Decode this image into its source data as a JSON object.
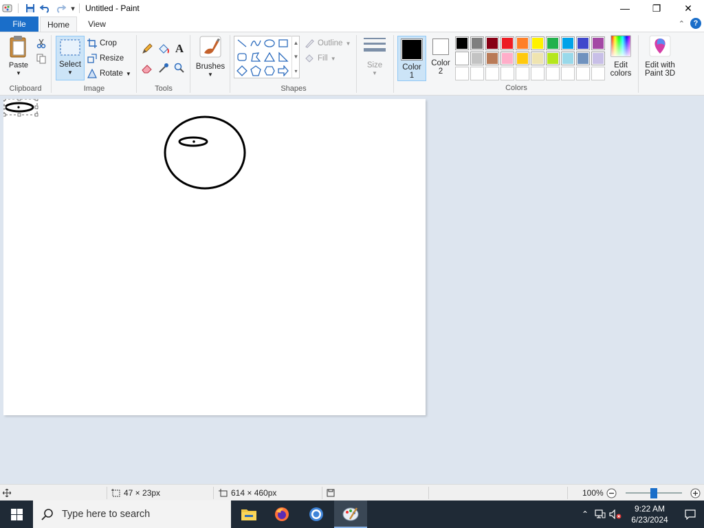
{
  "window": {
    "title": "Untitled - Paint",
    "minimize": "—",
    "restore": "❐",
    "close": "✕"
  },
  "quick_access": {
    "dropdown": "▾"
  },
  "tabs": {
    "file": "File",
    "home": "Home",
    "view": "View"
  },
  "ribbon": {
    "clipboard": {
      "label": "Clipboard",
      "paste": "Paste"
    },
    "image": {
      "label": "Image",
      "select": "Select",
      "crop": "Crop",
      "resize": "Resize",
      "rotate": "Rotate"
    },
    "tools": {
      "label": "Tools"
    },
    "brushes": {
      "label": "Brushes"
    },
    "shapes": {
      "label": "Shapes",
      "outline": "Outline",
      "fill": "Fill"
    },
    "size": {
      "label": "Size"
    },
    "colors": {
      "label": "Colors",
      "color1_label": "Color",
      "color1_num": "1",
      "color2_label": "Color",
      "color2_num": "2",
      "color1": "#000000",
      "color2": "#ffffff",
      "edit_colors_1": "Edit",
      "edit_colors_2": "colors",
      "paint3d_1": "Edit with",
      "paint3d_2": "Paint 3D",
      "palette_row1": [
        "#000000",
        "#7f7f7f",
        "#880015",
        "#ed1c24",
        "#ff7f27",
        "#fff200",
        "#22b14c",
        "#00a2e8",
        "#3f48cc",
        "#a349a4"
      ],
      "palette_row2": [
        "#ffffff",
        "#c3c3c3",
        "#b97a57",
        "#ffaec9",
        "#ffc90e",
        "#efe4b0",
        "#b5e61d",
        "#99d9ea",
        "#7092be",
        "#c8bfe7"
      ]
    }
  },
  "status": {
    "selection_size": "47 × 23px",
    "canvas_size": "614 × 460px",
    "zoom": "100%"
  },
  "taskbar": {
    "search_placeholder": "Type here to search",
    "time": "9:22 AM",
    "date": "6/23/2024"
  }
}
